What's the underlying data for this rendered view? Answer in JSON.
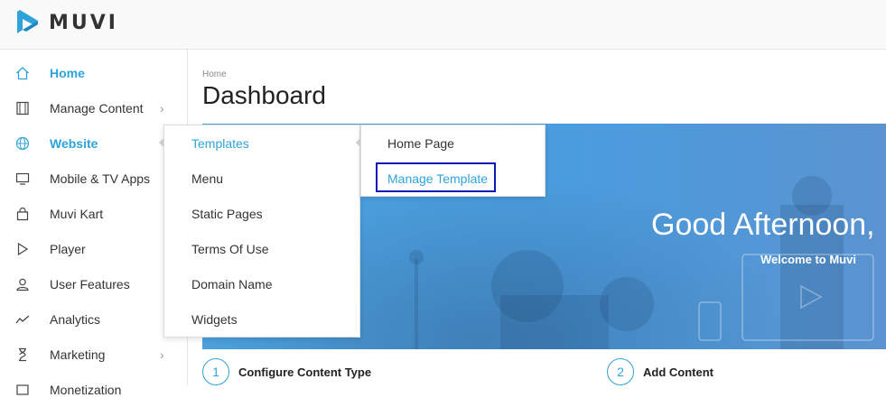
{
  "brand": {
    "name": "MUVI",
    "accent": "#2fa3d9"
  },
  "sidebar": {
    "items": [
      {
        "label": "Home",
        "icon": "home-icon",
        "active": true,
        "has_submenu": false
      },
      {
        "label": "Manage Content",
        "icon": "film-icon",
        "active": false,
        "has_submenu": true
      },
      {
        "label": "Website",
        "icon": "globe-icon",
        "active": true,
        "has_submenu": true
      },
      {
        "label": "Mobile & TV Apps",
        "icon": "monitor-icon",
        "active": false,
        "has_submenu": false
      },
      {
        "label": "Muvi Kart",
        "icon": "shopping-bag-icon",
        "active": false,
        "has_submenu": false
      },
      {
        "label": "Player",
        "icon": "play-icon",
        "active": false,
        "has_submenu": false
      },
      {
        "label": "User Features",
        "icon": "user-icon",
        "active": false,
        "has_submenu": false
      },
      {
        "label": "Analytics",
        "icon": "analytics-icon",
        "active": false,
        "has_submenu": false
      },
      {
        "label": "Marketing",
        "icon": "hourglass-icon",
        "active": false,
        "has_submenu": true
      },
      {
        "label": "Monetization",
        "icon": "monetization-icon",
        "active": false,
        "has_submenu": false
      }
    ]
  },
  "breadcrumb": "Home",
  "page_title": "Dashboard",
  "banner": {
    "greeting": "Good Afternoon,",
    "subtitle": "Welcome to Muvi"
  },
  "steps": [
    {
      "number": "1",
      "label": "Configure Content Type"
    },
    {
      "number": "2",
      "label": "Add Content"
    }
  ],
  "website_menu": {
    "items": [
      "Templates",
      "Menu",
      "Static Pages",
      "Terms Of Use",
      "Domain Name",
      "Widgets"
    ],
    "active_index": 0
  },
  "templates_menu": {
    "items": [
      "Home Page",
      "Manage Template"
    ],
    "highlighted_index": 1
  }
}
